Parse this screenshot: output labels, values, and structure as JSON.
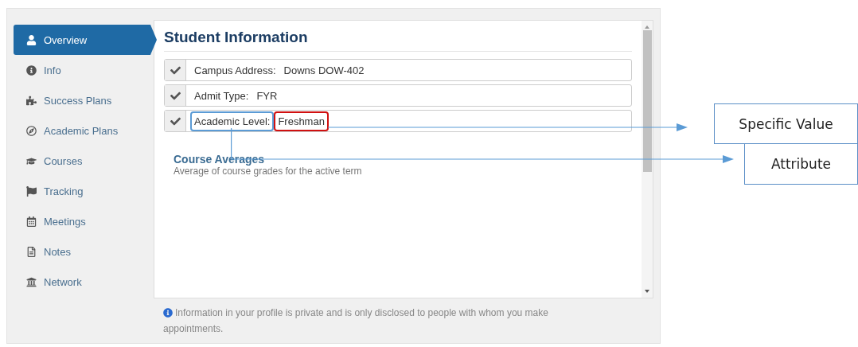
{
  "sidebar": {
    "items": [
      {
        "label": "Overview",
        "selected": true
      },
      {
        "label": "Info",
        "selected": false
      },
      {
        "label": "Success Plans",
        "selected": false
      },
      {
        "label": "Academic Plans",
        "selected": false
      },
      {
        "label": "Courses",
        "selected": false
      },
      {
        "label": "Tracking",
        "selected": false
      },
      {
        "label": "Meetings",
        "selected": false
      },
      {
        "label": "Notes",
        "selected": false
      },
      {
        "label": "Network",
        "selected": false
      }
    ]
  },
  "main": {
    "title": "Student Information",
    "fields": [
      {
        "label": "Campus Address:",
        "value": "Downs DOW-402",
        "checked": true,
        "highlighted": false
      },
      {
        "label": "Admit Type:",
        "value": "FYR",
        "checked": true,
        "highlighted": false
      },
      {
        "label": "Academic Level:",
        "value": "Freshman",
        "checked": true,
        "highlighted": true
      }
    ],
    "section": {
      "title": "Course Averages",
      "subtitle": "Average of course grades for the active term"
    }
  },
  "footer": {
    "text": "Information in your profile is private and is only disclosed to people with whom you make appointments."
  },
  "annotations": [
    {
      "label": "Specific Value"
    },
    {
      "label": "Attribute"
    }
  ]
}
